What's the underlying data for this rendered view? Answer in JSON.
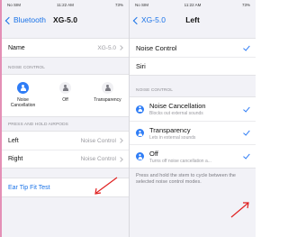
{
  "left_screen": {
    "status": {
      "carrier": "No SIM",
      "time": "11:22 AM",
      "battery": "73%"
    },
    "nav": {
      "back_label": "Bluetooth",
      "title": "XG-5.0"
    },
    "name_row": {
      "label": "Name",
      "value": "XG-5.0"
    },
    "noise_section_header": "NOISE CONTROL",
    "modes": [
      {
        "label_line1": "Noise",
        "label_line2": "Cancellation",
        "active": true
      },
      {
        "label_line1": "Off",
        "label_line2": "",
        "active": false
      },
      {
        "label_line1": "Transparency",
        "label_line2": "",
        "active": false
      }
    ],
    "press_section_header": "PRESS AND HOLD AIRPODS",
    "press_rows": [
      {
        "label": "Left",
        "value": "Noise Control"
      },
      {
        "label": "Right",
        "value": "Noise Control"
      }
    ],
    "ear_tip_label": "Ear Tip Fit Test"
  },
  "right_screen": {
    "status": {
      "carrier": "No SIM",
      "time": "11:22 AM",
      "battery": "73%"
    },
    "nav": {
      "back_label": "XG-5.0",
      "title": "Left"
    },
    "options": [
      {
        "label": "Noise Control",
        "checked": true
      },
      {
        "label": "Siri",
        "checked": false
      }
    ],
    "noise_section_header": "NOISE CONTROL",
    "noise_modes": [
      {
        "title": "Noise Cancellation",
        "subtitle": "Blocks out external sounds",
        "checked": true
      },
      {
        "title": "Transparency",
        "subtitle": "Lets in external sounds",
        "checked": true
      },
      {
        "title": "Off",
        "subtitle": "Turns off noise cancellation a...",
        "checked": true
      }
    ],
    "footer": "Press and hold the stem to cycle between the selected noise control modes."
  },
  "colors": {
    "accent": "#2f7df6",
    "link": "#1a73e8",
    "annotation": "#e02020",
    "frame": "#e48fb6"
  }
}
